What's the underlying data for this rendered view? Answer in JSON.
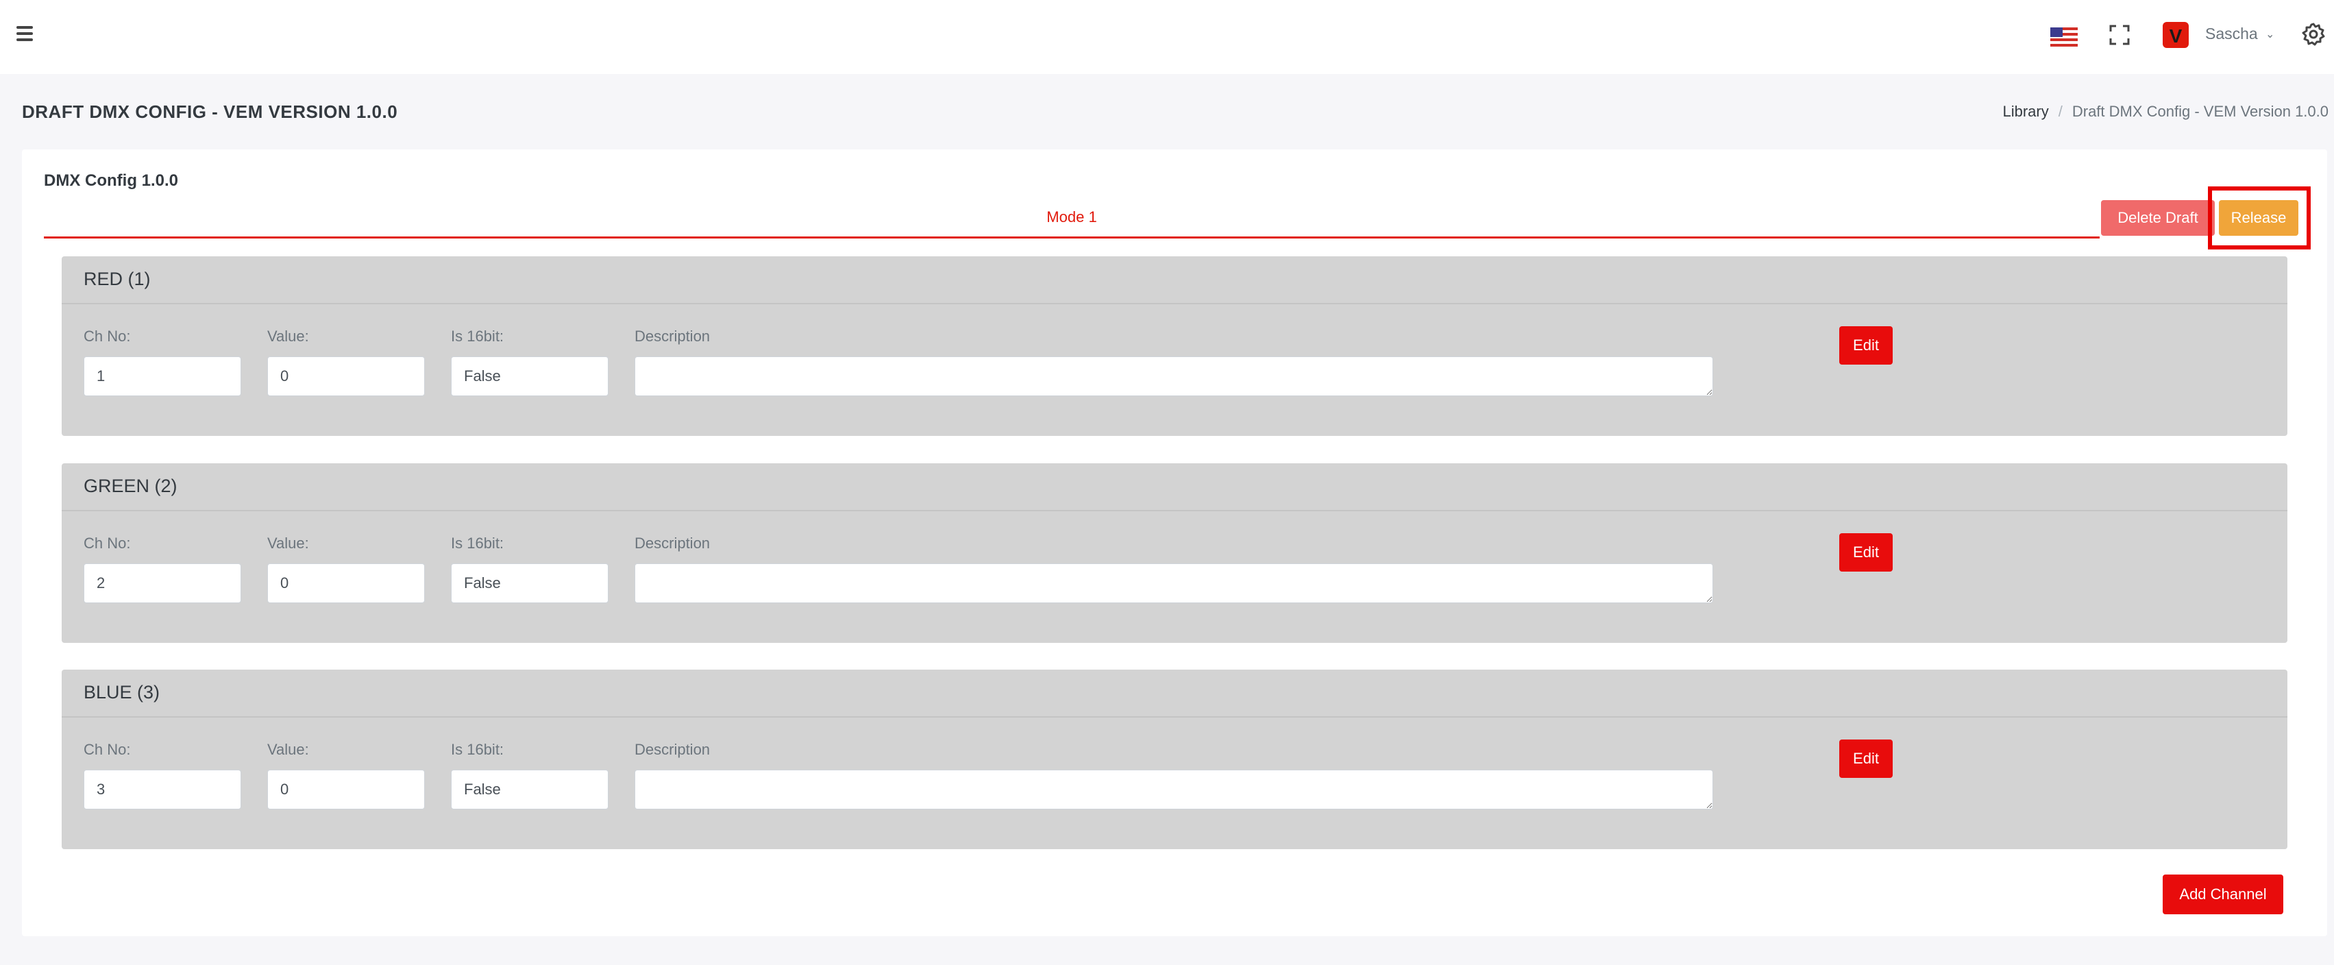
{
  "page": {
    "title": "DRAFT DMX CONFIG - VEM VERSION 1.0.0",
    "breadcrumb": [
      "Library",
      "Draft DMX Config - VEM Version 1.0.0"
    ]
  },
  "topbar": {
    "user_name": "Sascha",
    "avatar_letter": "V"
  },
  "card": {
    "title": "DMX Config 1.0.0",
    "tab": "Mode 1",
    "delete_label": "Delete Draft",
    "release_label": "Release",
    "add_label": "Add Channel"
  },
  "labels": {
    "ch_no": "Ch No:",
    "value": "Value:",
    "is16bit": "Is 16bit:",
    "description": "Description",
    "edit": "Edit"
  },
  "channels": [
    {
      "name": "RED (1)",
      "ch_no": "1",
      "value": "0",
      "is16bit": "False",
      "description": ""
    },
    {
      "name": "GREEN (2)",
      "ch_no": "2",
      "value": "0",
      "is16bit": "False",
      "description": ""
    },
    {
      "name": "BLUE (3)",
      "ch_no": "3",
      "value": "0",
      "is16bit": "False",
      "description": ""
    }
  ],
  "icons": {
    "menu": "hamburger-menu-icon",
    "flag": "us-flag-icon",
    "fullscreen": "fullscreen-icon",
    "caret": "chevron-down-icon",
    "settings": "gear-icon"
  },
  "colors": {
    "accent": "#e11a0c",
    "release": "#f0a53a",
    "delete": "#f06a6a",
    "panel": "#d3d3d3"
  }
}
